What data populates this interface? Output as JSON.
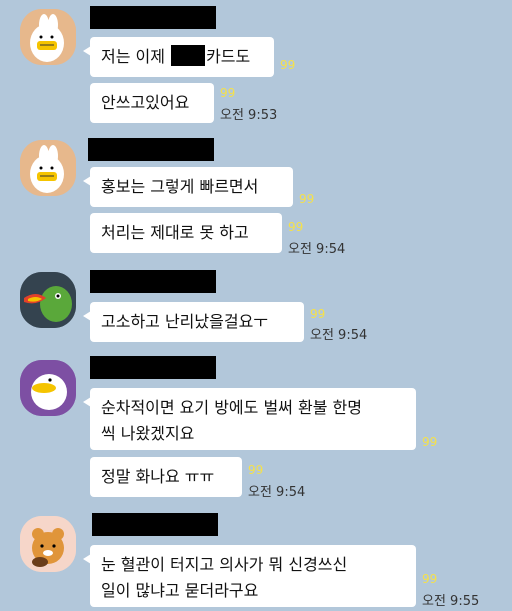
{
  "messages": [
    {
      "unread": "99",
      "text_before": "저는 이제 ",
      "text_after": "카드도"
    },
    {
      "unread": "99",
      "text": "안쓰고있어요",
      "time": "오전 9:53"
    },
    {
      "unread": "99",
      "text": "홍보는 그렇게 빠르면서"
    },
    {
      "unread": "99",
      "text": "처리는 제대로 못 하고",
      "time": "오전 9:54"
    },
    {
      "unread": "99",
      "text": "고소하고 난리났을걸요ㅜ",
      "time": "오전 9:54"
    },
    {
      "unread": "99",
      "line1": "순차적이면 요기 방에도 벌써 환불 한명",
      "line2": "씩 나왔겠지요"
    },
    {
      "unread": "99",
      "text": "정말 화나요 ㅠㅠ",
      "time": "오전 9:54"
    },
    {
      "unread": "99",
      "line1": "눈 혈관이 터지고 의사가 뭐 신경쓰신",
      "line2": "일이 많냐고 묻더라구요",
      "time": "오전 9:55"
    }
  ]
}
